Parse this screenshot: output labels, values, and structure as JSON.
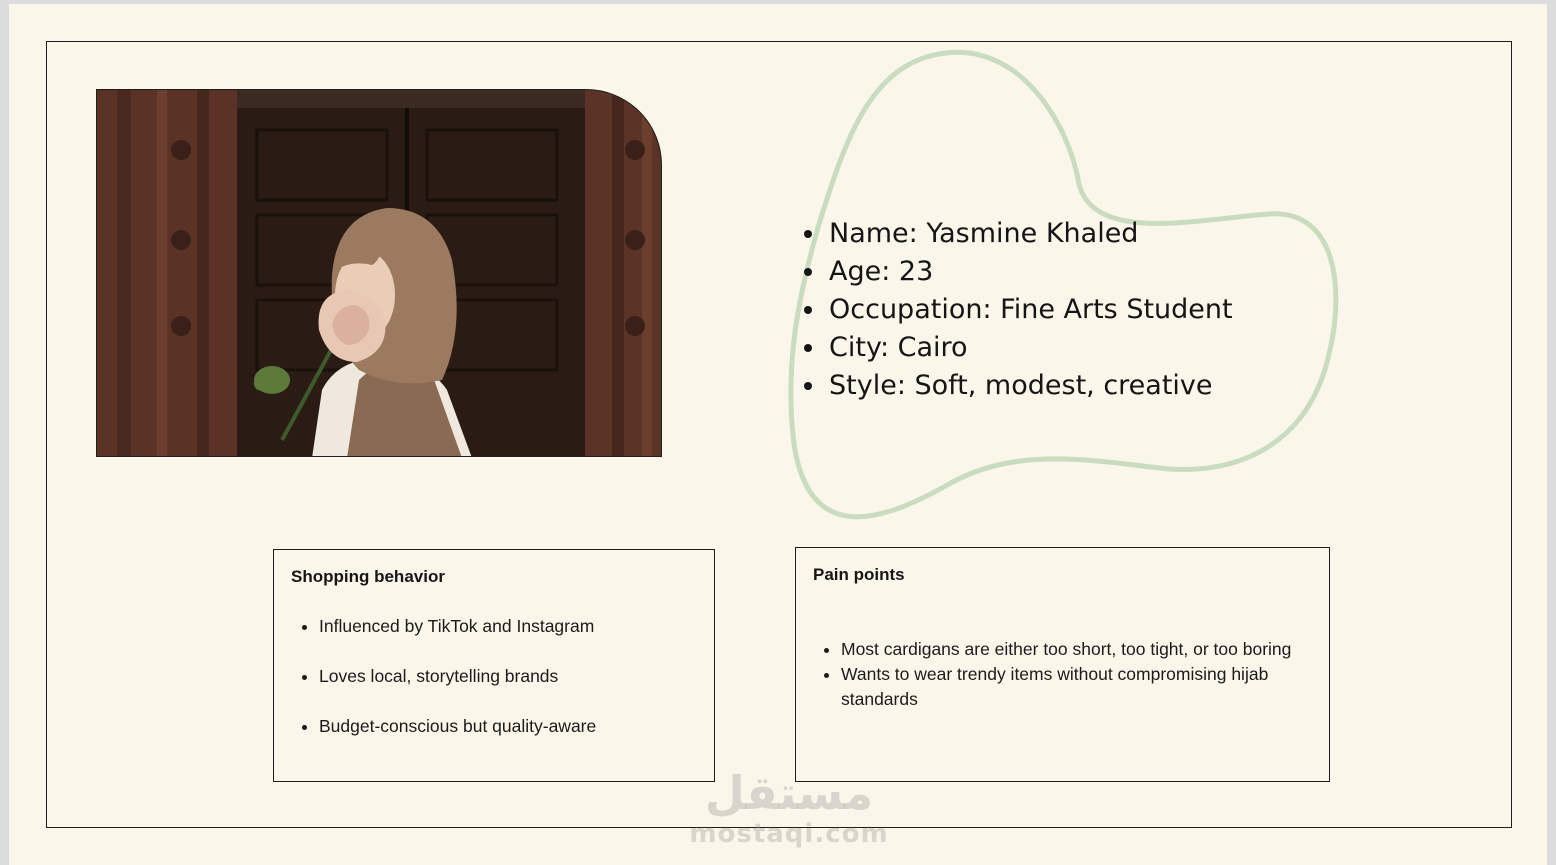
{
  "persona": {
    "info": [
      "Name: Yasmine Khaled",
      "Age: 23",
      "Occupation: Fine Arts Student",
      "City: Cairo",
      "Style: Soft, modest, creative"
    ]
  },
  "shopping": {
    "title": "Shopping behavior",
    "items": [
      "Influenced by TikTok and Instagram",
      "Loves local, storytelling brands",
      "Budget-conscious but quality-aware"
    ]
  },
  "pain": {
    "title": "Pain points",
    "items": [
      "Most cardigans are either too short, too tight, or too boring",
      "Wants to wear trendy items without compromising hijab standards"
    ]
  },
  "watermark": {
    "arabic": "مستقل",
    "latin": "mostaqi.com"
  },
  "colors": {
    "background": "#faf7ea",
    "blob_outline": "#c9dcc0",
    "border": "#1e1e1e"
  }
}
